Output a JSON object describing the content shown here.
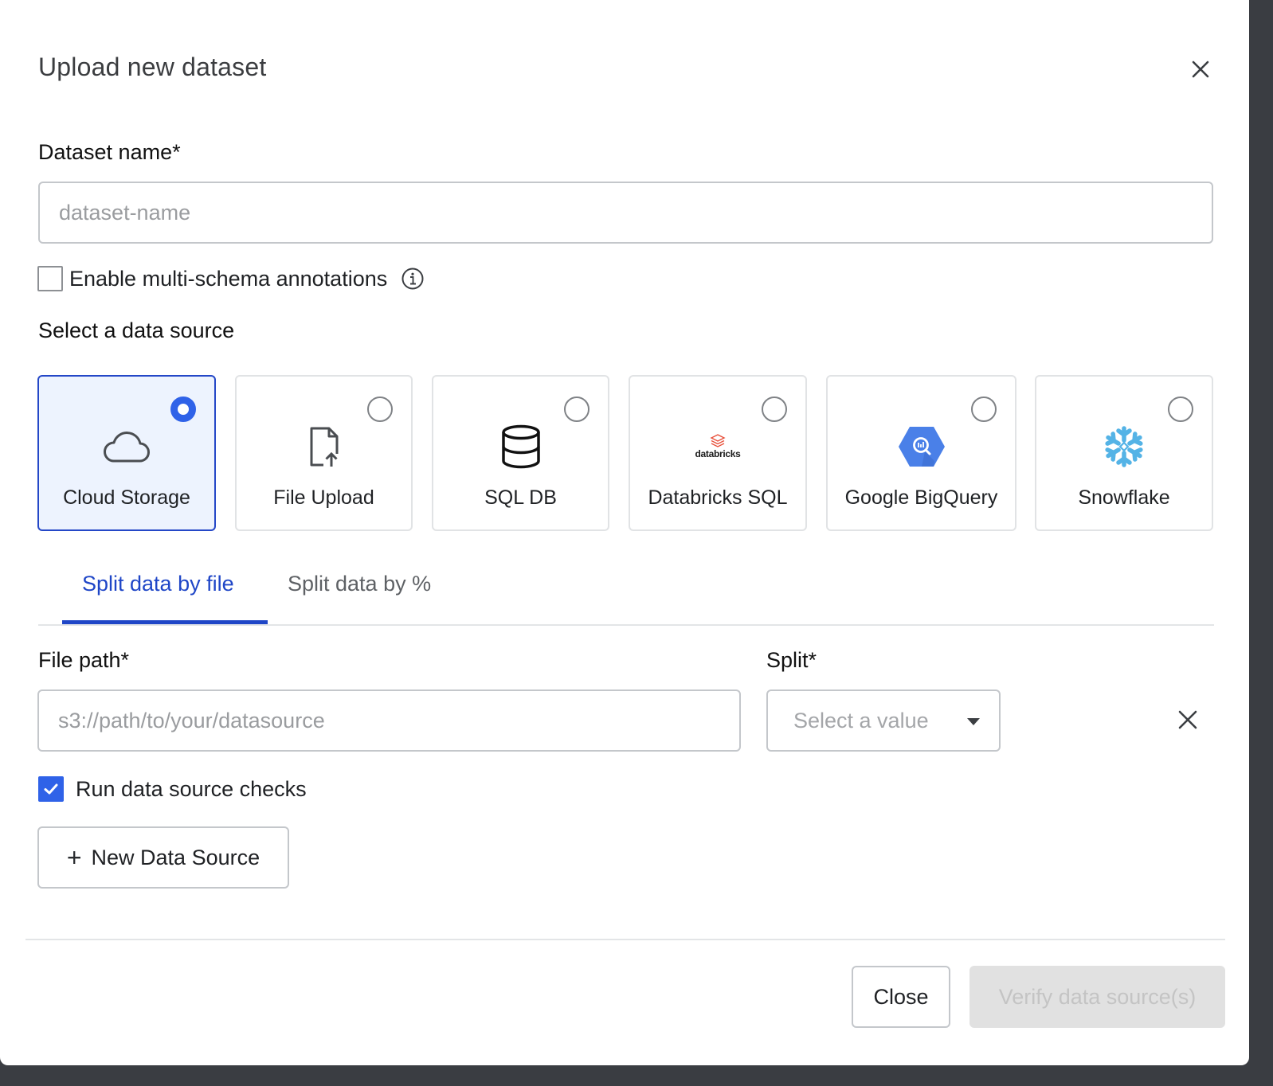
{
  "dialog": {
    "title": "Upload new dataset"
  },
  "dataset_name": {
    "label": "Dataset name*",
    "value": "",
    "placeholder": "dataset-name"
  },
  "multi_schema": {
    "label": "Enable multi-schema annotations",
    "checked": false
  },
  "data_source": {
    "heading": "Select a data source",
    "options": [
      {
        "label": "Cloud Storage",
        "icon": "cloud-icon",
        "selected": true
      },
      {
        "label": "File Upload",
        "icon": "file-upload-icon",
        "selected": false
      },
      {
        "label": "SQL DB",
        "icon": "database-icon",
        "selected": false
      },
      {
        "label": "Databricks SQL",
        "icon": "databricks-logo",
        "logo_text": "databricks",
        "selected": false
      },
      {
        "label": "Google BigQuery",
        "icon": "bigquery-logo",
        "selected": false
      },
      {
        "label": "Snowflake",
        "icon": "snowflake-logo",
        "selected": false
      }
    ]
  },
  "tabs": [
    {
      "label": "Split data by file",
      "active": true
    },
    {
      "label": "Split data by %",
      "active": false
    }
  ],
  "file_path": {
    "label": "File path*",
    "value": "",
    "placeholder": "s3://path/to/your/datasource"
  },
  "split": {
    "label": "Split*",
    "placeholder": "Select a value"
  },
  "run_checks": {
    "label": "Run data source checks",
    "checked": true
  },
  "buttons": {
    "new_source": "New Data Source",
    "close": "Close",
    "verify": "Verify data source(s)"
  },
  "colors": {
    "accent": "#2f62e8",
    "tab_active": "#1f46c7",
    "selected_card_bg": "#edf3fe",
    "databricks": "#e8513c",
    "bigquery": "#4a80e8",
    "snowflake": "#54b3e6"
  }
}
